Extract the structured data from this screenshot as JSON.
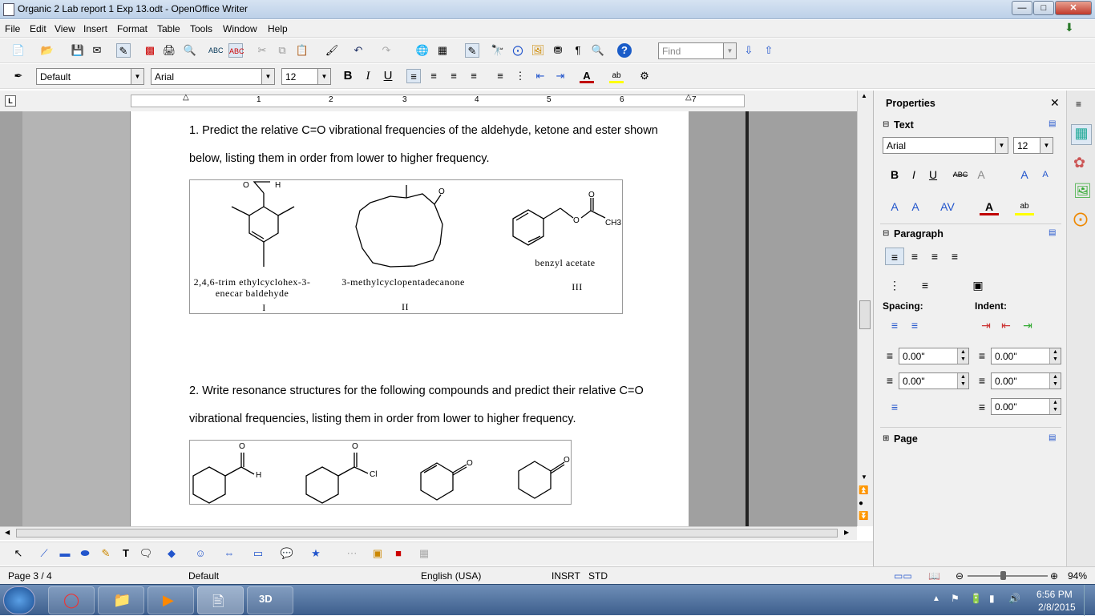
{
  "window": {
    "title": "Organic 2 Lab report 1 Exp 13.odt - OpenOffice Writer"
  },
  "menu": [
    "File",
    "Edit",
    "View",
    "Insert",
    "Format",
    "Table",
    "Tools",
    "Window",
    "Help"
  ],
  "toolbar": {
    "find_placeholder": "Find"
  },
  "formatting": {
    "style": "Default",
    "font": "Arial",
    "size": "12"
  },
  "ruler": {
    "numbers": [
      "1",
      "2",
      "3",
      "4",
      "5",
      "6",
      "7"
    ]
  },
  "document": {
    "q1_line1": "1. Predict the relative C=O vibrational frequencies of the aldehyde, ketone and ester shown",
    "q1_line2": "below, listing them in order from lower to higher frequency.",
    "compounds": [
      {
        "name_l1": "2,4,6-trim ethylcyclohex-3-",
        "name_l2": "enecar baldehyde",
        "numeral": "I"
      },
      {
        "name_l1": "3-methylcyclopentadecanone",
        "name_l2": "",
        "numeral": "II"
      },
      {
        "name_l1": "benzyl acetate",
        "name_l2": "",
        "numeral": "III"
      }
    ],
    "q2_line1": "2. Write resonance structures for the following compounds and predict their relative C=O",
    "q2_line2": "vibrational frequencies, listing them in order from lower to higher frequency.",
    "atom_labels": {
      "O": "O",
      "H": "H",
      "Cl": "Cl",
      "CH3": "CH3"
    }
  },
  "sidebar": {
    "title": "Properties",
    "text_section": "Text",
    "font": "Arial",
    "size": "12",
    "paragraph_section": "Paragraph",
    "spacing_label": "Spacing:",
    "indent_label": "Indent:",
    "spacing_above": "0.00\"",
    "spacing_below": "0.00\"",
    "indent_before": "0.00\"",
    "indent_after": "0.00\"",
    "first_line": "0.00\"",
    "page_section": "Page"
  },
  "status": {
    "page": "Page 3 / 4",
    "style": "Default",
    "language": "English (USA)",
    "insert_mode": "INSRT",
    "selection_mode": "STD",
    "zoom": "94%"
  },
  "taskbar": {
    "time": "6:56 PM",
    "date": "2/8/2015"
  },
  "colors": {
    "accent": "#3d5e8c",
    "font_color": "#c00000",
    "highlight": "#ffff00"
  }
}
